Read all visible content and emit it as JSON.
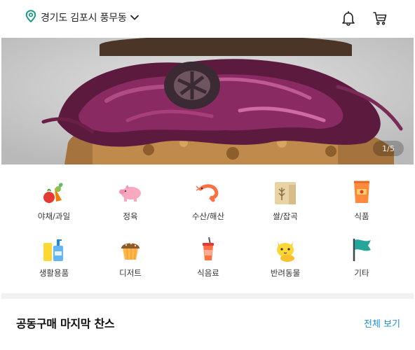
{
  "header": {
    "location": "경기도 김포시 풍무동",
    "location_icon": "map-pin-icon",
    "notification_icon": "bell-icon",
    "cart_icon": "cart-icon"
  },
  "banner": {
    "current": 1,
    "total": 5,
    "pager_text": "1/5"
  },
  "categories": [
    {
      "label": "야채/과일",
      "icon": "vegetable-fruit-icon"
    },
    {
      "label": "정육",
      "icon": "pig-icon"
    },
    {
      "label": "수산/해산",
      "icon": "shrimp-icon"
    },
    {
      "label": "쌀/잡곡",
      "icon": "rice-bag-icon"
    },
    {
      "label": "식품",
      "icon": "snack-package-icon"
    },
    {
      "label": "생활용품",
      "icon": "household-goods-icon"
    },
    {
      "label": "디저트",
      "icon": "cupcake-icon"
    },
    {
      "label": "식음료",
      "icon": "drink-cup-icon"
    },
    {
      "label": "반려동물",
      "icon": "cat-icon"
    },
    {
      "label": "기타",
      "icon": "flag-icon"
    }
  ],
  "section": {
    "title": "공동구매 마지막 찬스",
    "see_all": "전체 보기"
  },
  "colors": {
    "accent": "#1f8fd6",
    "location_pin": "#1a9b83"
  }
}
